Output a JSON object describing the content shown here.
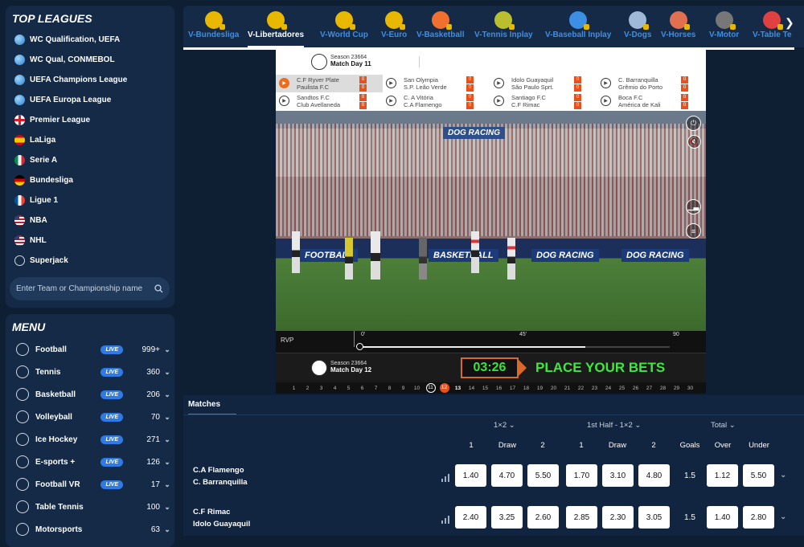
{
  "leagues": {
    "title": "TOP LEAGUES",
    "items": [
      {
        "label": "WC Qualification, UEFA",
        "flag": "globe"
      },
      {
        "label": "WC Qual, CONMEBOL",
        "flag": "globe"
      },
      {
        "label": "UEFA Champions League",
        "flag": "globe"
      },
      {
        "label": "UEFA Europa League",
        "flag": "globe"
      },
      {
        "label": "Premier League",
        "flag": "eng"
      },
      {
        "label": "LaLiga",
        "flag": "es"
      },
      {
        "label": "Serie A",
        "flag": "it"
      },
      {
        "label": "Bundesliga",
        "flag": "de"
      },
      {
        "label": "Ligue 1",
        "flag": "fr"
      },
      {
        "label": "NBA",
        "flag": "us"
      },
      {
        "label": "NHL",
        "flag": "us"
      },
      {
        "label": "Superjack",
        "flag": "sj"
      }
    ],
    "search_placeholder": "Enter Team or Championship name"
  },
  "menu": {
    "title": "MENU",
    "live_label": "LIVE",
    "items": [
      {
        "label": "Football",
        "live": true,
        "count": "999+"
      },
      {
        "label": "Tennis",
        "live": true,
        "count": "360"
      },
      {
        "label": "Basketball",
        "live": true,
        "count": "206"
      },
      {
        "label": "Volleyball",
        "live": true,
        "count": "70"
      },
      {
        "label": "Ice Hockey",
        "live": true,
        "count": "271"
      },
      {
        "label": "E-sports +",
        "live": true,
        "count": "126"
      },
      {
        "label": "Football VR",
        "live": true,
        "count": "17"
      },
      {
        "label": "Table Tennis",
        "live": false,
        "count": "100"
      },
      {
        "label": "Motorsports",
        "live": false,
        "count": "63"
      }
    ]
  },
  "topnav": {
    "tabs": [
      {
        "label": "V-Bundesliga",
        "color": "#e8b800"
      },
      {
        "label": "V-Libertadores",
        "color": "#e8b800",
        "active": true
      },
      {
        "label": "V-World Cup",
        "color": "#e8b800"
      },
      {
        "label": "V-Euro",
        "color": "#e8b800"
      },
      {
        "label": "V-Basketball",
        "color": "#f07030"
      },
      {
        "label": "V-Tennis Inplay",
        "color": "#b8c030"
      },
      {
        "label": "V-Baseball Inplay",
        "color": "#3d8fe6"
      },
      {
        "label": "V-Dogs",
        "color": "#9fb8d8"
      },
      {
        "label": "V-Horses",
        "color": "#e07050"
      },
      {
        "label": "V-Motor",
        "color": "#777777"
      },
      {
        "label": "V-Table Te",
        "color": "#e04040"
      }
    ]
  },
  "player": {
    "season_top": "Season 23664",
    "matchday_top": "Match Day 11",
    "results": [
      {
        "home": "C.F Ryver Plate",
        "away": "Paulista F.C",
        "hs": "0",
        "as": "0",
        "highlight": true
      },
      {
        "home": "Sandtos F.C",
        "away": "Club Avellaneda",
        "hs": "0",
        "as": "0"
      },
      {
        "home": "San Olympia",
        "away": "S.P. Leão Verde",
        "hs": "0",
        "as": "0"
      },
      {
        "home": "C. A Vitória",
        "away": "C.A Flamengo",
        "hs": "0",
        "as": "0"
      },
      {
        "home": "Idolo Guayaquil",
        "away": "São Paulo Sprt.",
        "hs": "0",
        "as": "0"
      },
      {
        "home": "Santiago F.C",
        "away": "C.F Rimac",
        "hs": "0",
        "as": "0"
      },
      {
        "home": "C. Barranquilla",
        "away": "Grêmio do Porto",
        "hs": "0",
        "as": "0"
      },
      {
        "home": "Boca F.C",
        "away": "América de Kali",
        "hs": "0",
        "as": "0"
      }
    ],
    "boards": [
      "DOG RACING",
      "FOOTBALL",
      "BASKETBALL",
      "DOG RACING",
      "DOG RACING"
    ],
    "rvp_label": "RVP",
    "tl_start": "0'",
    "tl_mid": "45'",
    "tl_end": "90",
    "season_bottom": "Season 23664",
    "matchday_bottom": "Match Day 12",
    "timer": "03:26",
    "place_bets": "PLACE YOUR BETS",
    "days": [
      "1",
      "2",
      "3",
      "4",
      "5",
      "6",
      "7",
      "8",
      "9",
      "10",
      "11",
      "12",
      "13",
      "14",
      "15",
      "16",
      "17",
      "18",
      "19",
      "20",
      "21",
      "22",
      "23",
      "24",
      "25",
      "26",
      "27",
      "28",
      "29",
      "30"
    ],
    "done_day": "11",
    "current_day": "12",
    "next_day": "13"
  },
  "matches": {
    "tab": "Matches",
    "group1": "1×2",
    "group2": "1st Half - 1×2",
    "group3": "Total",
    "sub": [
      "1",
      "Draw",
      "2",
      "1",
      "Draw",
      "2",
      "Goals",
      "Over",
      "Under"
    ],
    "rows": [
      {
        "home": "C.A Flamengo",
        "away": "C. Barranquilla",
        "odds": [
          "1.40",
          "4.70",
          "5.50",
          "1.70",
          "3.10",
          "4.80"
        ],
        "goals": "1.5",
        "over": "1.12",
        "under": "5.50"
      },
      {
        "home": "C.F Rimac",
        "away": "Idolo Guayaquil",
        "odds": [
          "2.40",
          "3.25",
          "2.60",
          "2.85",
          "2.30",
          "3.05"
        ],
        "goals": "1.5",
        "over": "1.40",
        "under": "2.80"
      }
    ]
  }
}
